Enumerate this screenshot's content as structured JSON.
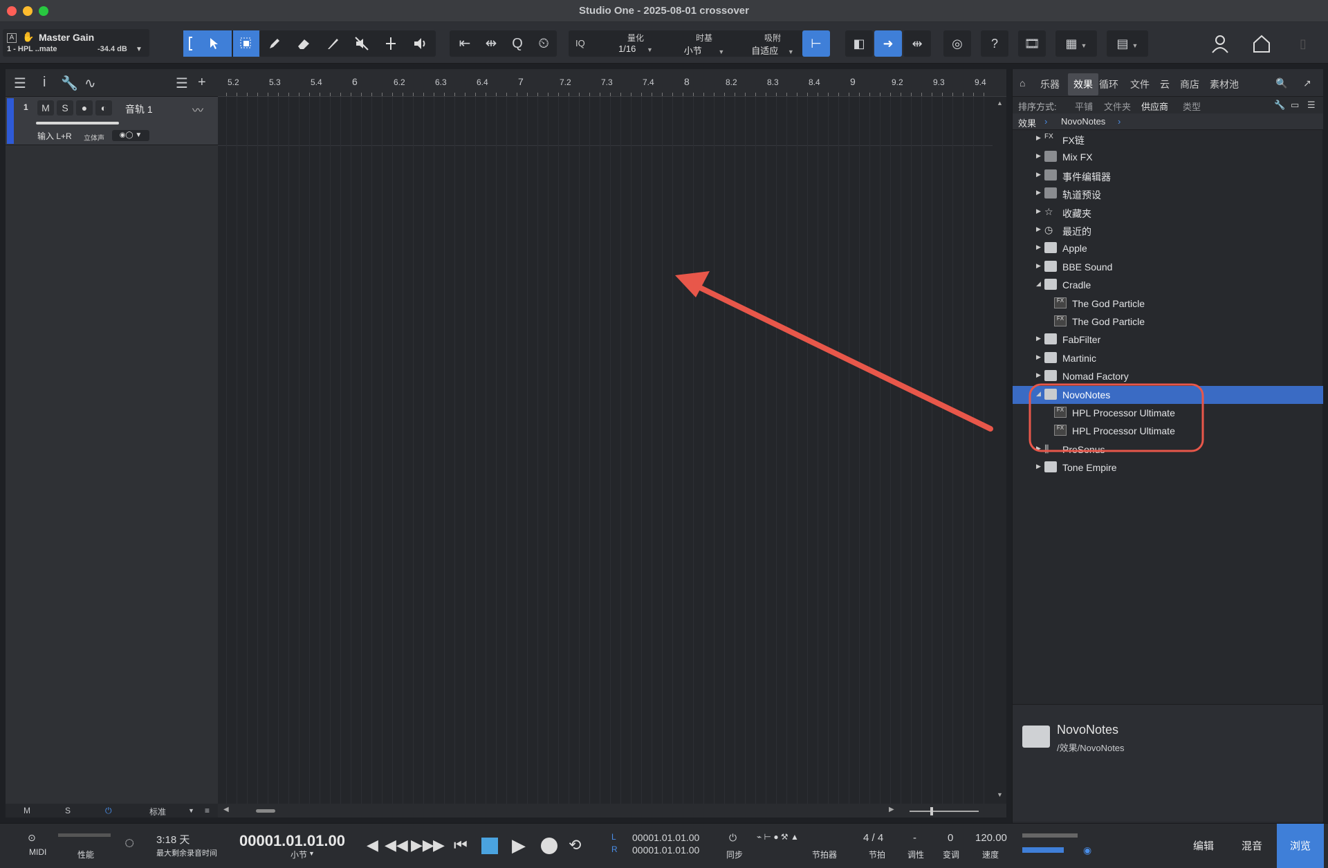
{
  "window": {
    "title": "Studio One - 2025-08-01 crossover"
  },
  "master": {
    "name": "Master Gain",
    "insert": "1 - HPL ..mate",
    "level": "-34.4 dB"
  },
  "toolbar": {
    "iq_label": "IQ",
    "quantize_label": "量化",
    "quantize_value": "1/16",
    "timebase_label": "时基",
    "timebase_value": "小节",
    "snap_label": "吸附",
    "snap_value": "自适应"
  },
  "track": {
    "number": "1",
    "mute": "M",
    "solo": "S",
    "name": "音轨 1",
    "input": "输入 L+R",
    "stereo": "立体声"
  },
  "track_footer": {
    "m": "M",
    "s": "S",
    "mode": "标准"
  },
  "ruler": [
    "5.2",
    "5.3",
    "5.4",
    "6",
    "6.2",
    "6.3",
    "6.4",
    "7",
    "7.2",
    "7.3",
    "7.4",
    "8",
    "8.2",
    "8.3",
    "8.4",
    "9",
    "9.2",
    "9.3",
    "9.4"
  ],
  "browser": {
    "tabs": [
      "乐器",
      "效果",
      "循环",
      "文件",
      "云",
      "商店",
      "素材池"
    ],
    "sort_label": "排序方式:",
    "sort_options": [
      "平铺",
      "文件夹",
      "供应商",
      "类型"
    ],
    "breadcrumb": [
      "效果",
      "NovoNotes"
    ],
    "items": [
      {
        "label": "FX链",
        "kind": "fxchain"
      },
      {
        "label": "Mix FX",
        "kind": "mixfx"
      },
      {
        "label": "事件编辑器",
        "kind": "event"
      },
      {
        "label": "轨道预设",
        "kind": "preset"
      },
      {
        "label": "收藏夹",
        "kind": "star"
      },
      {
        "label": "最近的",
        "kind": "clock"
      },
      {
        "label": "Apple",
        "kind": "folder"
      },
      {
        "label": "BBE Sound",
        "kind": "folder"
      },
      {
        "label": "Cradle",
        "kind": "folder-open"
      },
      {
        "label": "The God Particle",
        "kind": "plugin"
      },
      {
        "label": "The God Particle",
        "kind": "plugin"
      },
      {
        "label": "FabFilter",
        "kind": "folder"
      },
      {
        "label": "Martinic",
        "kind": "folder"
      },
      {
        "label": "Nomad Factory",
        "kind": "folder"
      },
      {
        "label": "NovoNotes",
        "kind": "folder-open",
        "selected": true
      },
      {
        "label": "HPL Processor Ultimate",
        "kind": "plugin"
      },
      {
        "label": "HPL Processor Ultimate",
        "kind": "plugin"
      },
      {
        "label": "PreSonus",
        "kind": "presonus"
      },
      {
        "label": "Tone Empire",
        "kind": "folder"
      }
    ],
    "info": {
      "name": "NovoNotes",
      "path": "/效果/NovoNotes"
    }
  },
  "transport": {
    "midi": "MIDI",
    "performance": "性能",
    "record_time": "3:18 天",
    "record_time_label": "最大剩余录音时间",
    "position": "00001.01.01.00",
    "position_unit": "小节",
    "loop_l": "00001.01.01.00",
    "loop_r": "00001.01.01.00",
    "sync_label": "同步",
    "metronome_label": "节拍器",
    "signature": "4 / 4",
    "signature_label": "节拍",
    "key": "-",
    "key_label": "调性",
    "transpose": "0",
    "transpose_label": "变调",
    "tempo": "120.00",
    "tempo_label": "速度",
    "modes": [
      "编辑",
      "混音",
      "浏览"
    ]
  },
  "colors": {
    "accent": "#3f7fd8",
    "selected_row": "#3a6bc4",
    "track_color": "#2e5ad6",
    "annotation": "#e8574a"
  }
}
